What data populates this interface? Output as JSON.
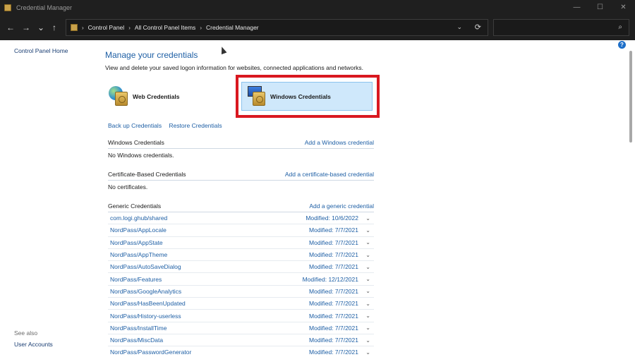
{
  "window": {
    "title": "Credential Manager",
    "controls": {
      "minimize": "—",
      "maximize": "☐",
      "close": "✕"
    }
  },
  "nav": {
    "back": "←",
    "forward": "→",
    "recent": "⌄",
    "up": "↑",
    "breadcrumb": [
      "Control Panel",
      "All Control Panel Items",
      "Credential Manager"
    ],
    "dropdown": "⌄",
    "refresh": "⟳",
    "search_placeholder": "",
    "search_icon": "⌕"
  },
  "left_pane": {
    "home_link": "Control Panel Home",
    "see_also": "See also",
    "user_accounts": "User Accounts"
  },
  "main": {
    "title": "Manage your credentials",
    "description": "View and delete your saved logon information for websites, connected applications and networks.",
    "tiles": {
      "web": "Web Credentials",
      "windows": "Windows Credentials"
    },
    "backup": "Back up Credentials",
    "restore": "Restore Credentials",
    "windows_section": {
      "label": "Windows Credentials",
      "action": "Add a Windows credential",
      "empty": "No Windows credentials."
    },
    "cert_section": {
      "label": "Certificate-Based Credentials",
      "action": "Add a certificate-based credential",
      "empty": "No certificates."
    },
    "generic_section": {
      "label": "Generic Credentials",
      "action": "Add a generic credential"
    },
    "generic_items": [
      {
        "name": "com.logi.ghub/shared",
        "modified": "Modified:  10/6/2022"
      },
      {
        "name": "NordPass/AppLocale",
        "modified": "Modified:  7/7/2021"
      },
      {
        "name": "NordPass/AppState",
        "modified": "Modified:  7/7/2021"
      },
      {
        "name": "NordPass/AppTheme",
        "modified": "Modified:  7/7/2021"
      },
      {
        "name": "NordPass/AutoSaveDialog",
        "modified": "Modified:  7/7/2021"
      },
      {
        "name": "NordPass/Features",
        "modified": "Modified:  12/12/2021"
      },
      {
        "name": "NordPass/GoogleAnalytics",
        "modified": "Modified:  7/7/2021"
      },
      {
        "name": "NordPass/HasBeenUpdated",
        "modified": "Modified:  7/7/2021"
      },
      {
        "name": "NordPass/History-userless",
        "modified": "Modified:  7/7/2021"
      },
      {
        "name": "NordPass/InstallTime",
        "modified": "Modified:  7/7/2021"
      },
      {
        "name": "NordPass/MiscData",
        "modified": "Modified:  7/7/2021"
      },
      {
        "name": "NordPass/PasswordGenerator",
        "modified": "Modified:  7/7/2021"
      }
    ],
    "help": "?"
  },
  "colors": {
    "highlight": "#d91820",
    "link": "#1e5fa5",
    "titlebar": "#1f1f1f",
    "selected_tile": "#cfe8fb"
  }
}
